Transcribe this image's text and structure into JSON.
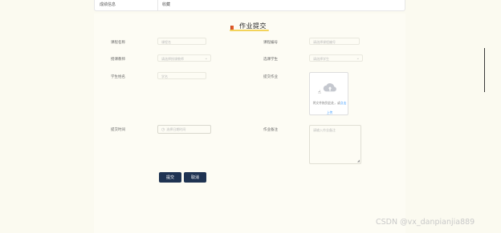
{
  "top_table": {
    "col1": "成绩信息",
    "col2": "收藏"
  },
  "form": {
    "title": "作业提交",
    "fields": {
      "course_name": {
        "label": "课程名称",
        "placeholder": "课程名"
      },
      "course_no": {
        "label": "课程编号",
        "placeholder": "请选择课程编号"
      },
      "teacher": {
        "label": "授课教师",
        "placeholder": "请选择授课教师"
      },
      "student_select": {
        "label": "选课学生",
        "placeholder": "请选择学生"
      },
      "student_name": {
        "label": "学生姓名",
        "placeholder": "学名"
      },
      "homework": {
        "label": "提交作业",
        "upload_text": "将文件拖到此处，或",
        "upload_link": "点击",
        "upload_link2": "上传"
      },
      "submit_time": {
        "label": "提交时间",
        "placeholder": "选择日期时间"
      },
      "remark": {
        "label": "作业备注",
        "placeholder": "请输入作业备注"
      }
    },
    "buttons": {
      "submit": "提交",
      "cancel": "取消"
    }
  },
  "watermark": "CSDN @vx_danpianjia889",
  "icons": [
    "flag-icon",
    "cloud-upload-icon",
    "pointer-cursor-icon",
    "chevron-down-icon",
    "clock-icon",
    "resize-grip-icon"
  ]
}
